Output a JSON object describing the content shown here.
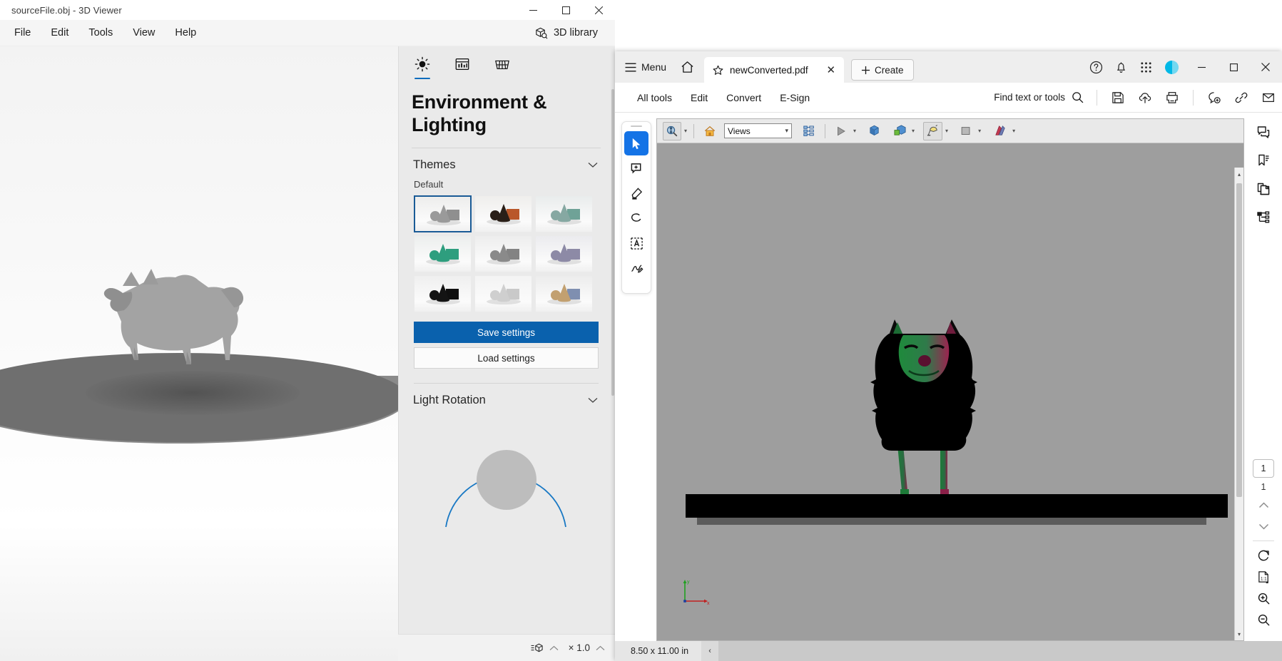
{
  "viewer3d": {
    "title": "sourceFile.obj - 3D Viewer",
    "window_controls": {
      "minimize": "─",
      "maximize": "☐",
      "close": "✕"
    },
    "menu": [
      "File",
      "Edit",
      "Tools",
      "View",
      "Help"
    ],
    "library_button": "3D library",
    "panel": {
      "tabs": [
        {
          "name": "environment-lighting-tab",
          "icon": "sun-icon",
          "active": true
        },
        {
          "name": "statistics-tab",
          "icon": "chart-panel-icon",
          "active": false
        },
        {
          "name": "grid-tab",
          "icon": "grid-icon",
          "active": false
        }
      ],
      "heading": "Environment & Lighting",
      "themes": {
        "section_title": "Themes",
        "sub_label": "Default",
        "selected_index": 0,
        "items": [
          {
            "name": "theme-gray-light",
            "bg": "#ededec",
            "shape": "#9a9a9a",
            "accent": "#8f8f8f",
            "selected": true
          },
          {
            "name": "theme-orange-dark",
            "bg": "#efeeec",
            "shape": "#2a1f18",
            "accent": "#b9572a",
            "selected": false
          },
          {
            "name": "theme-teal-soft",
            "bg": "#e9ecec",
            "shape": "#86a8a2",
            "accent": "#6fa297",
            "selected": false
          },
          {
            "name": "theme-green",
            "bg": "#eceeed",
            "shape": "#2e9e7e",
            "accent": "#2e9e7e",
            "selected": false
          },
          {
            "name": "theme-neutral",
            "bg": "#ededed",
            "shape": "#8a8a8a",
            "accent": "#838383",
            "selected": false
          },
          {
            "name": "theme-violet",
            "bg": "#ebebee",
            "shape": "#8d8aa6",
            "accent": "#8d8aa6",
            "selected": false
          },
          {
            "name": "theme-black",
            "bg": "#efefef",
            "shape": "#141414",
            "accent": "#101010",
            "selected": false
          },
          {
            "name": "theme-white",
            "bg": "#f3f3f3",
            "shape": "#cfcfcf",
            "accent": "#c9c9c9",
            "selected": false
          },
          {
            "name": "theme-colorful",
            "bg": "#ececec",
            "shape": "#c2a070",
            "accent": "#7f8fb0",
            "selected": false
          }
        ]
      },
      "save_button": "Save settings",
      "load_button": "Load settings",
      "light_rotation": {
        "section_title": "Light Rotation",
        "icon": "sun-icon"
      }
    },
    "statusbar": {
      "model_icon": "model-stats-icon",
      "zoom_label": "× 1.0",
      "expand_caret": "⌃"
    }
  },
  "acrobat": {
    "tabbar": {
      "menu_label": "Menu",
      "menu_icon": "hamburger-icon",
      "home_icon": "home-icon",
      "tab": {
        "star_icon": "star-icon",
        "label": "newConverted.pdf",
        "close": "✕"
      },
      "create_button": "Create",
      "create_icon": "plus-icon",
      "right_icons": [
        "help-icon",
        "bell-icon",
        "apps-grid-icon",
        "avatar"
      ],
      "window_controls": {
        "minimize": "─",
        "maximize": "☐",
        "close": "✕"
      }
    },
    "toolbar": {
      "items": [
        "All tools",
        "Edit",
        "Convert",
        "E-Sign"
      ],
      "find_label": "Find text or tools",
      "find_icon": "search-icon",
      "right_icons": [
        "save-icon",
        "cloud-upload-icon",
        "print-icon",
        "comment-add-icon",
        "link-icon",
        "mail-icon"
      ]
    },
    "left_tools": [
      {
        "name": "select-tool",
        "icon": "cursor-arrow-icon",
        "active": true
      },
      {
        "name": "comment-tool",
        "icon": "comment-plus-icon",
        "active": false
      },
      {
        "name": "highlight-tool",
        "icon": "highlighter-icon",
        "active": false
      },
      {
        "name": "draw-tool",
        "icon": "lasso-icon",
        "active": false
      },
      {
        "name": "text-edit-tool",
        "icon": "text-box-icon",
        "active": false
      },
      {
        "name": "sign-tool",
        "icon": "signature-icon",
        "active": false
      }
    ],
    "pdf_toolbar": {
      "rotate_icon": "3d-rotate-icon",
      "home_icon": "home-orange-icon",
      "views_select": {
        "value": "Views",
        "placeholder": "Views"
      },
      "model_tree_icon": "model-tree-icon",
      "play_icon": "play-icon",
      "cube_icon": "cube-blue-icon",
      "cross_section_icon": "cross-section-icon",
      "light_icon": "lighting-icon",
      "background_icon": "background-color-icon",
      "render_icon": "render-mode-icon"
    },
    "right_tools": [
      {
        "name": "comments-panel",
        "icon": "comment-icon"
      },
      {
        "name": "bookmarks-panel",
        "icon": "bookmark-icon"
      },
      {
        "name": "pages-panel",
        "icon": "pages-icon"
      },
      {
        "name": "layers-panel",
        "icon": "layers-tree-icon"
      }
    ],
    "page_nav": {
      "current_page": "1",
      "total_pages": "1",
      "prev_icon": "chevron-up-icon",
      "next_icon": "chevron-down-icon",
      "rotate_icon": "rotate-cw-icon",
      "fit_icon": "fit-page-icon",
      "zoom_in_icon": "zoom-in-icon",
      "zoom_out_icon": "zoom-out-icon"
    },
    "statusbar": {
      "page_size": "8.50 x 11.00 in",
      "collapse_icon": "‹"
    },
    "model_colors": {
      "body": "#000000",
      "highlight_green": "#1f8a3c",
      "highlight_magenta": "#9c2350",
      "platform": "#000000",
      "page_bg": "#9e9e9e",
      "axis_x": "#c02020",
      "axis_y": "#20a020"
    }
  }
}
